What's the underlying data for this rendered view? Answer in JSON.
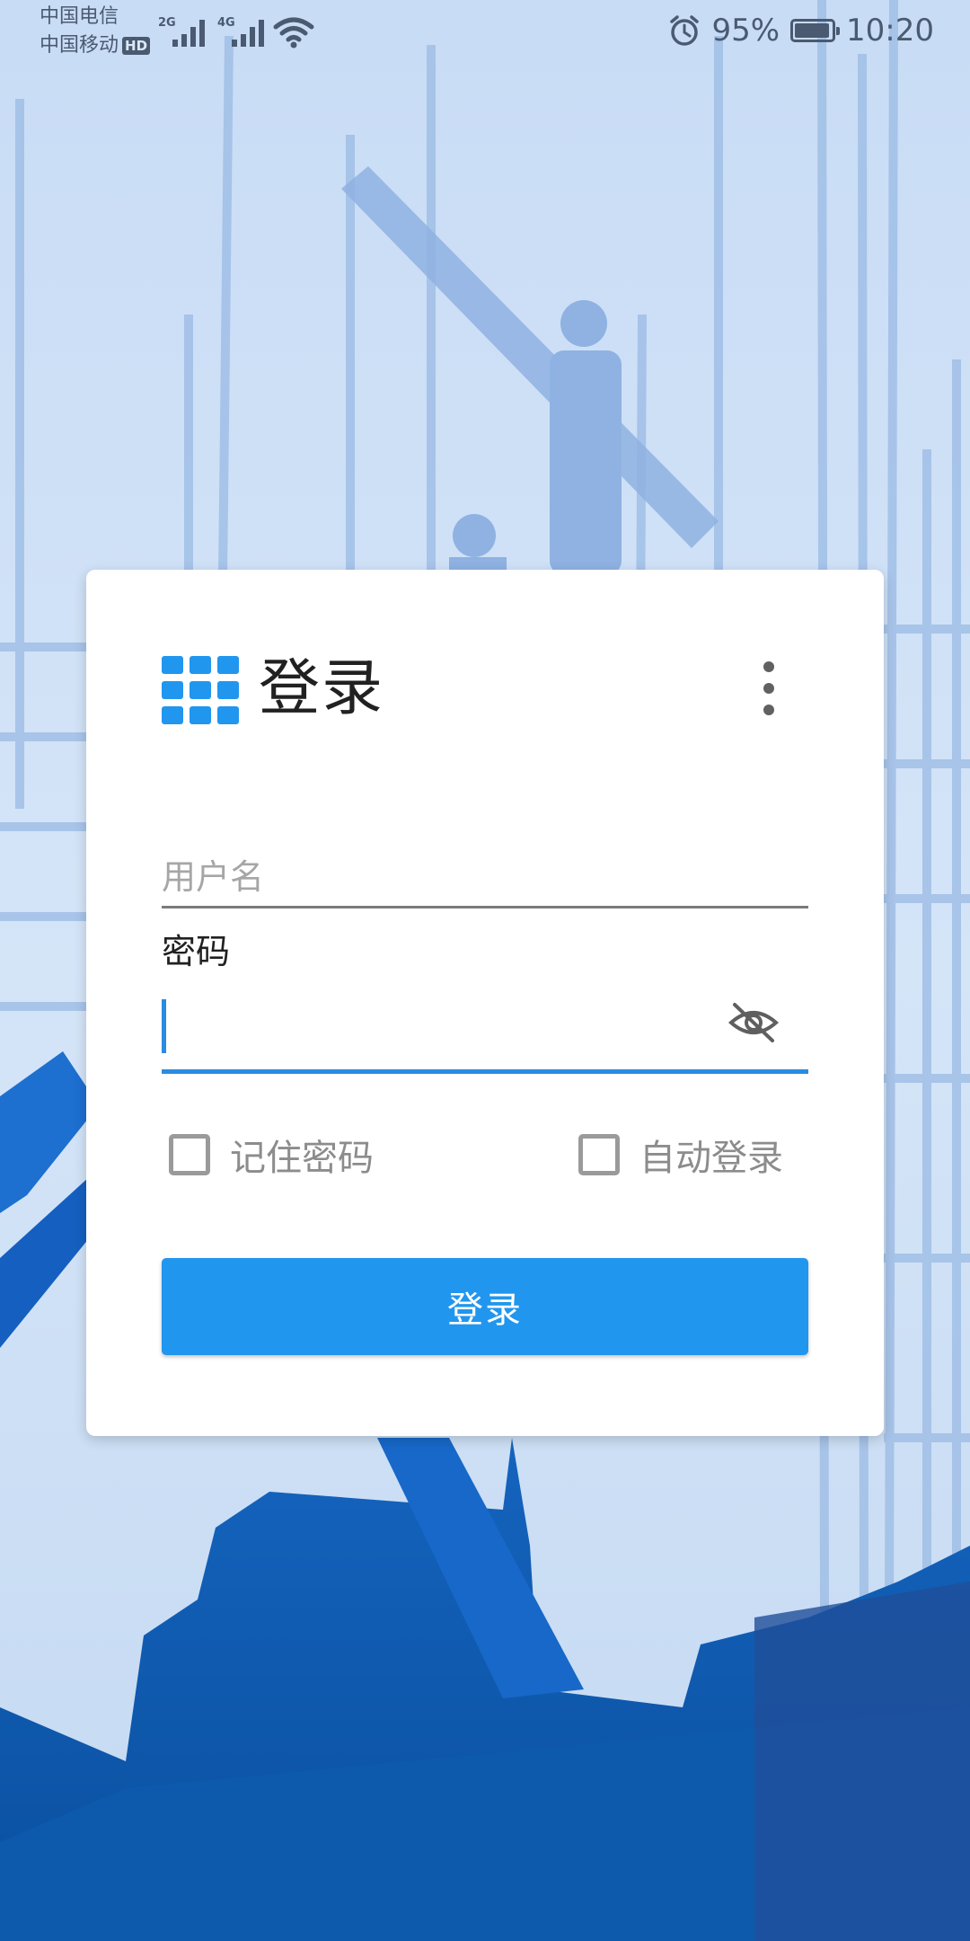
{
  "status_bar": {
    "carrier_1": "中国电信",
    "carrier_2": "中国移动",
    "hd_badge": "HD",
    "signal_1_network": "2G",
    "signal_2_network": "4G",
    "battery_percent": "95%",
    "battery_level": 0.95,
    "time": "10:20",
    "icons": [
      "signal-icon",
      "signal-icon",
      "wifi-icon",
      "alarm-icon",
      "battery-icon"
    ]
  },
  "login_card": {
    "title": "登录",
    "title_icon": "app-grid-icon",
    "menu_icon": "more-vertical-icon",
    "username": {
      "value": "",
      "placeholder": "用户名"
    },
    "password": {
      "label": "密码",
      "value": "",
      "toggle_icon": "eye-off-icon"
    },
    "remember_password": {
      "label": "记住密码",
      "checked": false
    },
    "auto_login": {
      "label": "自动登录",
      "checked": false
    },
    "submit_label": "登录"
  },
  "colors": {
    "accent": "#2196ef",
    "focus_underline": "#2a8be0",
    "background_sky": "#c9dcf4",
    "background_deep": "#0a4f9e"
  }
}
